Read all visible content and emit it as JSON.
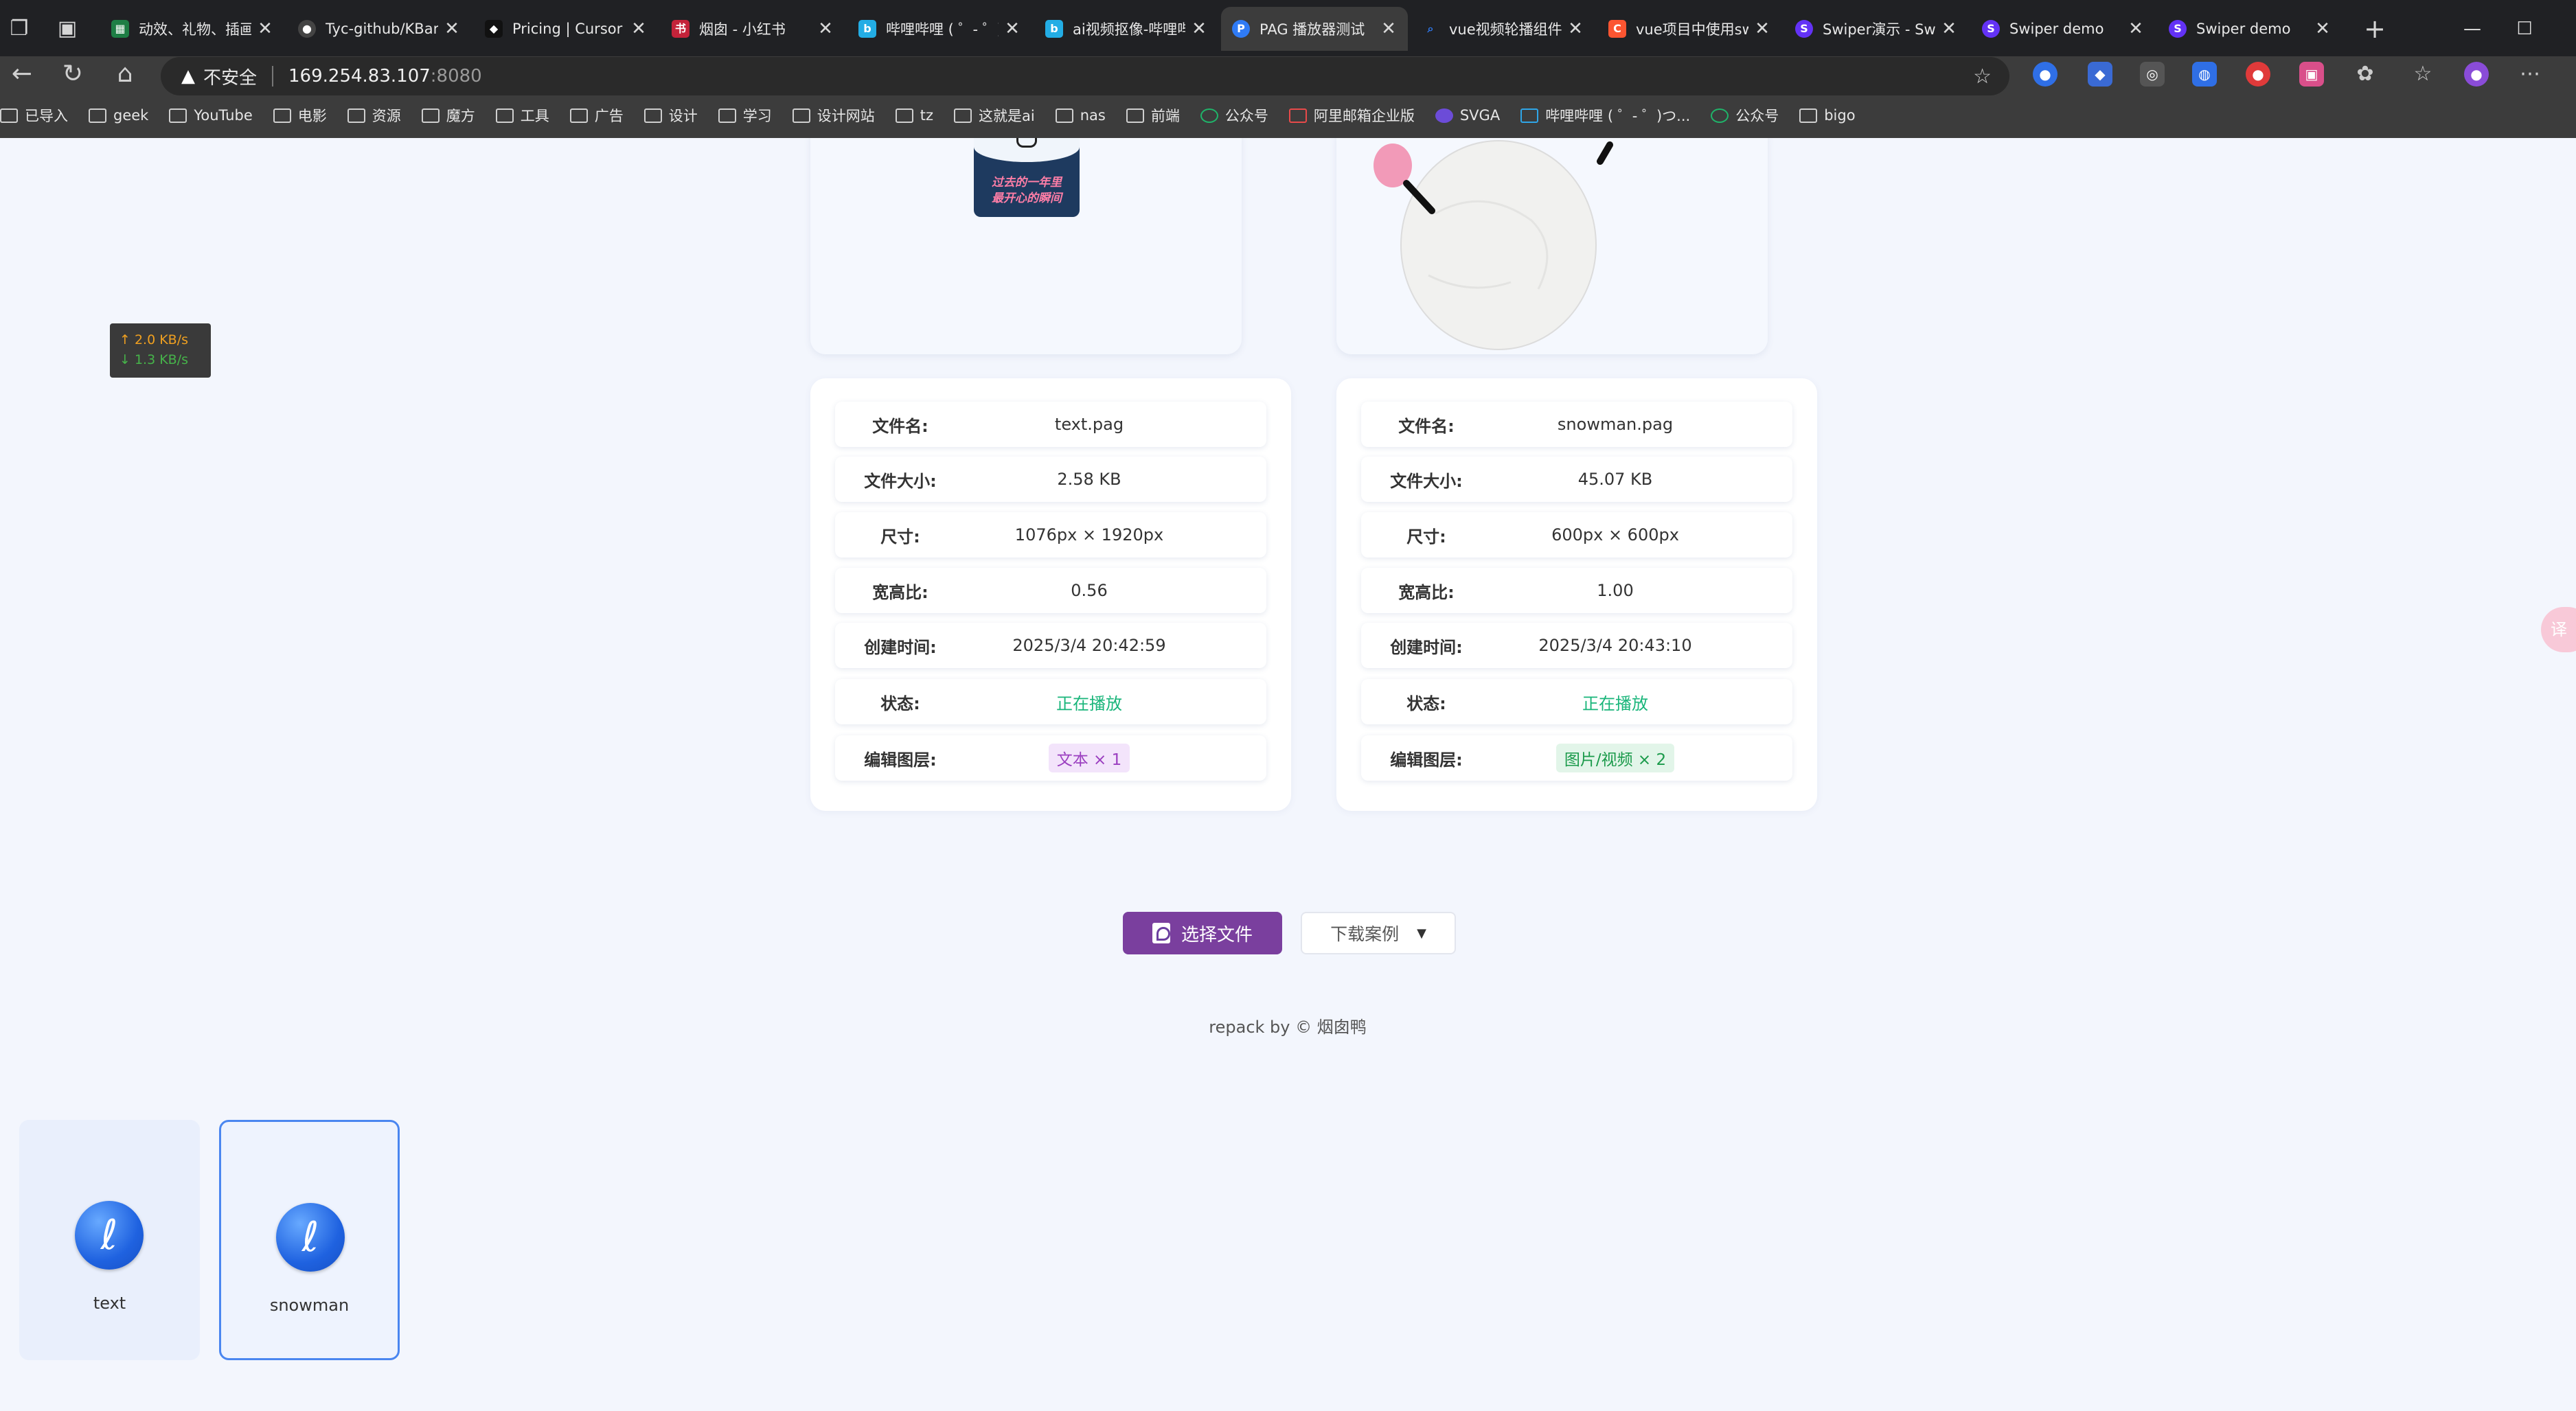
{
  "browser": {
    "tabs": [
      {
        "title": "动效、礼物、插画",
        "favicon": "sheet-icon",
        "color": "#1e7e45"
      },
      {
        "title": "Tyc-github/KBar_",
        "favicon": "github-icon",
        "color": "#444444"
      },
      {
        "title": "Pricing | Cursor -",
        "favicon": "cursor-icon",
        "color": "#111111"
      },
      {
        "title": "烟囱 - 小红书",
        "favicon": "xiaohongshu-icon",
        "color": "#c4233a"
      },
      {
        "title": "哔哩哔哩 ( ゜- ゜)つ",
        "favicon": "bilibili-icon",
        "color": "#23ade5"
      },
      {
        "title": "ai视频抠像-哔哩哔",
        "favicon": "bilibili-icon",
        "color": "#23ade5"
      },
      {
        "title": "PAG 播放器测试",
        "favicon": "pag-icon",
        "color": "#2f7bf5",
        "active": true
      },
      {
        "title": "vue视频轮播组件",
        "favicon": "search-icon",
        "color": "#2f7bf5"
      },
      {
        "title": "vue项目中使用swi",
        "favicon": "csdn-icon",
        "color": "#fc5531"
      },
      {
        "title": "Swiper演示 - Swip",
        "favicon": "swiper-icon",
        "color": "#6332f6"
      },
      {
        "title": "Swiper demo",
        "favicon": "swiper-icon",
        "color": "#6332f6"
      },
      {
        "title": "Swiper demo",
        "favicon": "swiper-icon",
        "color": "#6332f6"
      }
    ],
    "address": {
      "warning": "不安全",
      "host": "169.254.83.107",
      "port": ":8080"
    },
    "bookmarks": [
      {
        "label": "已导入",
        "type": "folder"
      },
      {
        "label": "geek",
        "type": "folder"
      },
      {
        "label": "YouTube",
        "type": "folder"
      },
      {
        "label": "电影",
        "type": "folder"
      },
      {
        "label": "资源",
        "type": "folder"
      },
      {
        "label": "魔方",
        "type": "folder"
      },
      {
        "label": "工具",
        "type": "folder"
      },
      {
        "label": "广告",
        "type": "folder"
      },
      {
        "label": "设计",
        "type": "folder"
      },
      {
        "label": "学习",
        "type": "folder"
      },
      {
        "label": "设计网站",
        "type": "folder"
      },
      {
        "label": "tz",
        "type": "folder"
      },
      {
        "label": "这就是ai",
        "type": "folder"
      },
      {
        "label": "nas",
        "type": "folder"
      },
      {
        "label": "前端",
        "type": "folder"
      },
      {
        "label": "公众号",
        "type": "wechat"
      },
      {
        "label": "阿里邮箱企业版",
        "type": "mail"
      },
      {
        "label": "SVGA",
        "type": "svga"
      },
      {
        "label": "哔哩哔哩 ( ゜- ゜)つ...",
        "type": "bilibili"
      },
      {
        "label": "公众号",
        "type": "wechat"
      },
      {
        "label": "bigo",
        "type": "folder"
      }
    ]
  },
  "thumb_text_lines": [
    "过去的一年里",
    "最开心的瞬间"
  ],
  "info_labels": {
    "filename": "文件名:",
    "filesize": "文件大小:",
    "dimensions": "尺寸:",
    "ratio": "宽高比:",
    "created": "创建时间:",
    "status": "状态:",
    "layers": "编辑图层:"
  },
  "files": [
    {
      "filename": "text.pag",
      "filesize": "2.58 KB",
      "dimensions": "1076px × 1920px",
      "ratio": "0.56",
      "created": "2025/3/4 20:42:59",
      "status": "正在播放",
      "layers": "文本 × 1"
    },
    {
      "filename": "snowman.pag",
      "filesize": "45.07 KB",
      "dimensions": "600px × 600px",
      "ratio": "1.00",
      "created": "2025/3/4 20:43:10",
      "status": "正在播放",
      "layers": "图片/视频 × 2"
    }
  ],
  "actions": {
    "select_file": "选择文件",
    "download_examples": "下载案例"
  },
  "footer": "repack by © 烟囱鸭",
  "thumbnails": [
    {
      "name": "text",
      "selected": false
    },
    {
      "name": "snowman",
      "selected": true
    }
  ],
  "network_speed": {
    "up": "↑ 2.0 KB/s",
    "down": "↓ 1.3 KB/s"
  },
  "side_bubble": "译"
}
